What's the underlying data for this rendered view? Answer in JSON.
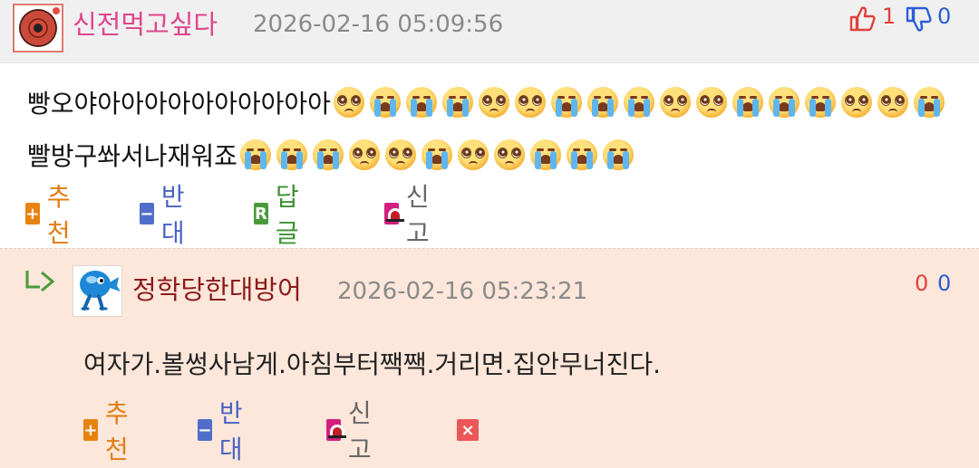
{
  "comment": {
    "nickname": "신전먹고싶다",
    "timestamp": "2026-02-16 05:09:56",
    "upvotes": "1",
    "downvotes": "0",
    "line1_text": "빵오야아아아아아아아아아아",
    "line1_emojis": [
      "pleading",
      "crying",
      "crying",
      "crying",
      "pleading",
      "pleading",
      "crying",
      "crying",
      "crying",
      "pleading",
      "pleading",
      "crying",
      "crying",
      "crying",
      "pleading",
      "pleading",
      "crying"
    ],
    "line2_text": "빨방구쏴서나재워죠",
    "line2_emojis": [
      "crying",
      "crying",
      "crying",
      "pleading",
      "pleading",
      "crying",
      "pleading",
      "pleading",
      "crying",
      "crying",
      "crying"
    ],
    "actions": {
      "recommend": "추천",
      "oppose": "반대",
      "reply_icon": "R",
      "reply": "답글",
      "report": "신고"
    }
  },
  "reply": {
    "nickname": "정학당한대방어",
    "timestamp": "2026-02-16 05:23:21",
    "upvotes": "0",
    "downvotes": "0",
    "text": "여자가.볼썽사남게.아침부터짹짹.거리면.집안무너진다.",
    "actions": {
      "recommend": "추천",
      "oppose": "반대",
      "report": "신고",
      "delete_icon": "×"
    }
  },
  "icons": {
    "upvote": "thumbs-up-icon",
    "downvote": "thumbs-down-icon",
    "reply_arrow": "reply-arrow-icon",
    "report": "siren-icon",
    "delete": "close-icon"
  },
  "colors": {
    "nick_main": "#e0458d",
    "nick_reply": "#8b1a1a",
    "up": "#e0413a",
    "down": "#2c5dd6",
    "recommend": "#e07c12",
    "oppose": "#4a63c4",
    "reply": "#3f9034",
    "reply_bg": "#fce7da"
  }
}
